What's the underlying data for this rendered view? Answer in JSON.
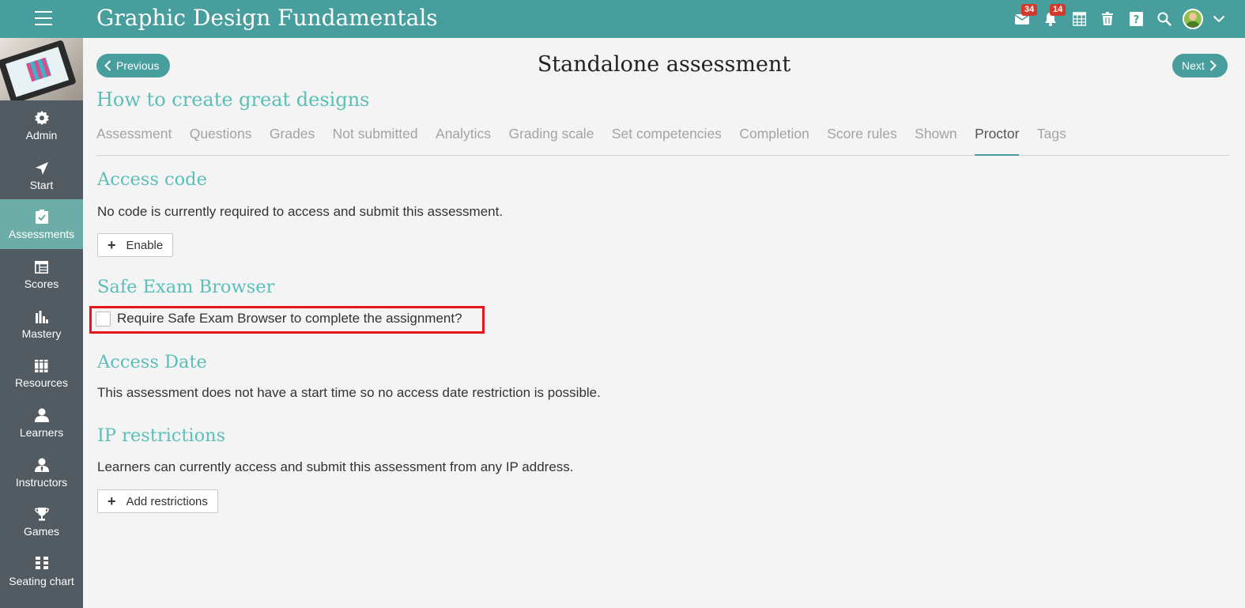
{
  "app": {
    "title": "Graphic Design Fundamentals",
    "accent_color": "#479e9c",
    "heading_color": "#5bbfb8",
    "sidebar_color": "#525b62",
    "active_nav_color": "#6dada8"
  },
  "topbar": {
    "messages_icon": "envelope-icon",
    "messages_badge": "34",
    "notifications_icon": "bell-icon",
    "notifications_badge": "14",
    "calendar_icon": "calendar-icon",
    "trash_icon": "trash-icon",
    "help_icon": "help-icon",
    "search_icon": "search-icon",
    "user_menu_icon": "chevron-down-icon",
    "badge_color": "#d33a2c"
  },
  "sidebar": {
    "items": [
      {
        "label": "Admin",
        "icon": "gear-icon"
      },
      {
        "label": "Start",
        "icon": "navigation-arrow-icon"
      },
      {
        "label": "Assessments",
        "icon": "checkbox-icon"
      },
      {
        "label": "Scores",
        "icon": "table-icon"
      },
      {
        "label": "Mastery",
        "icon": "bar-chart-icon"
      },
      {
        "label": "Resources",
        "icon": "books-icon"
      },
      {
        "label": "Learners",
        "icon": "person-icon"
      },
      {
        "label": "Instructors",
        "icon": "instructor-icon"
      },
      {
        "label": "Games",
        "icon": "trophy-icon"
      },
      {
        "label": "Seating chart",
        "icon": "seating-icon"
      }
    ],
    "active_item": "Assessments"
  },
  "header": {
    "previous_label": "Previous",
    "next_label": "Next",
    "page_title": "Standalone assessment",
    "subtitle": "How to create great designs"
  },
  "tabs": {
    "items": [
      "Assessment",
      "Questions",
      "Grades",
      "Not submitted",
      "Analytics",
      "Grading scale",
      "Set competencies",
      "Completion",
      "Score rules",
      "Shown",
      "Proctor",
      "Tags"
    ],
    "active": "Proctor"
  },
  "sections": {
    "access_code": {
      "heading": "Access code",
      "text": "No code is currently required to access and submit this assessment.",
      "button_label": "Enable"
    },
    "safe_exam": {
      "heading": "Safe Exam Browser",
      "checkbox_label": "Require Safe Exam Browser to complete the assignment?",
      "checked": false,
      "highlight_color": "#e8151b"
    },
    "access_date": {
      "heading": "Access Date",
      "text": "This assessment does not have a start time so no access date restriction is possible."
    },
    "ip_restrictions": {
      "heading": "IP restrictions",
      "text": "Learners can currently access and submit this assessment from any IP address.",
      "button_label": "Add restrictions"
    }
  }
}
